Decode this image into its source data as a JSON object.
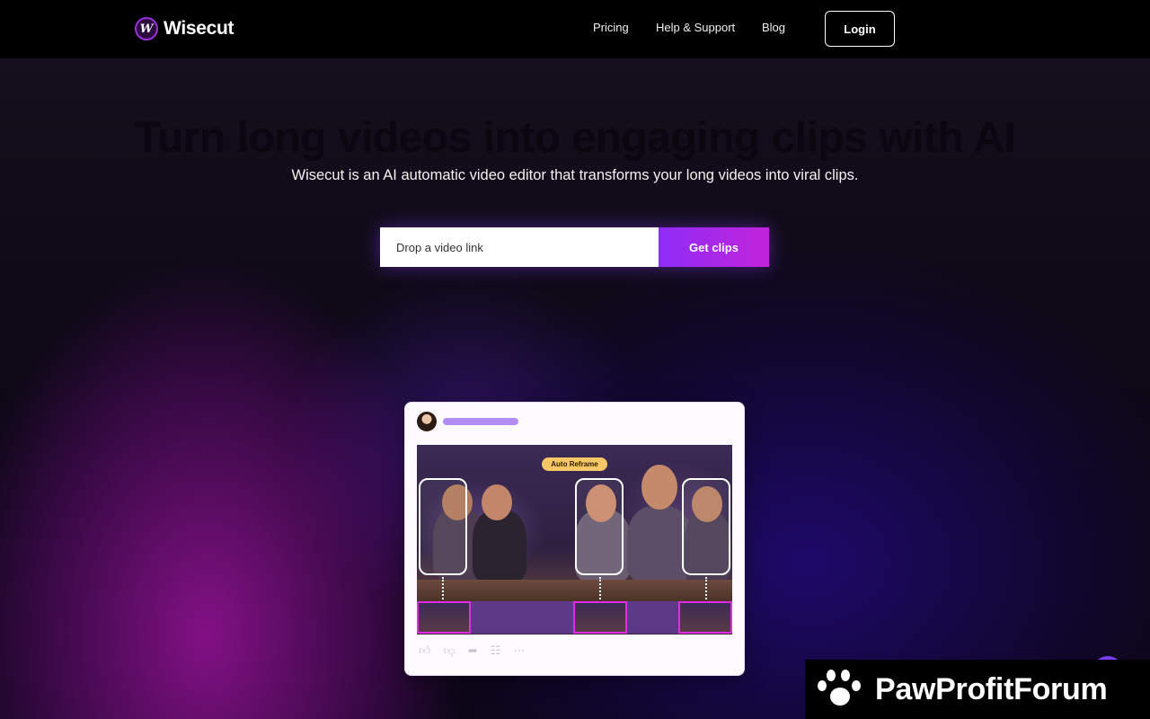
{
  "nav": {
    "brand": "Wisecut",
    "logo_glyph": "W",
    "links": [
      "Pricing",
      "Help & Support",
      "Blog"
    ],
    "login_label": "Login"
  },
  "hero": {
    "headline": "Turn long videos into engaging clips with AI",
    "subtitle": "Wisecut is an AI automatic video editor that transforms your long videos into viral clips.",
    "input_placeholder": "Drop a video link",
    "cta_label": "Get clips"
  },
  "preview": {
    "tag_label": "Auto Reframe",
    "actions": [
      "thumbs-up-icon",
      "thumbs-down-icon",
      "share-icon",
      "save-icon",
      "more-icon"
    ]
  },
  "watermark": {
    "text": "PawProfitForum"
  },
  "colors": {
    "accent_start": "#8f2cf7",
    "accent_end": "#c124d9",
    "tag_bg": "#f7c765",
    "thumb_border": "#e12be5"
  }
}
